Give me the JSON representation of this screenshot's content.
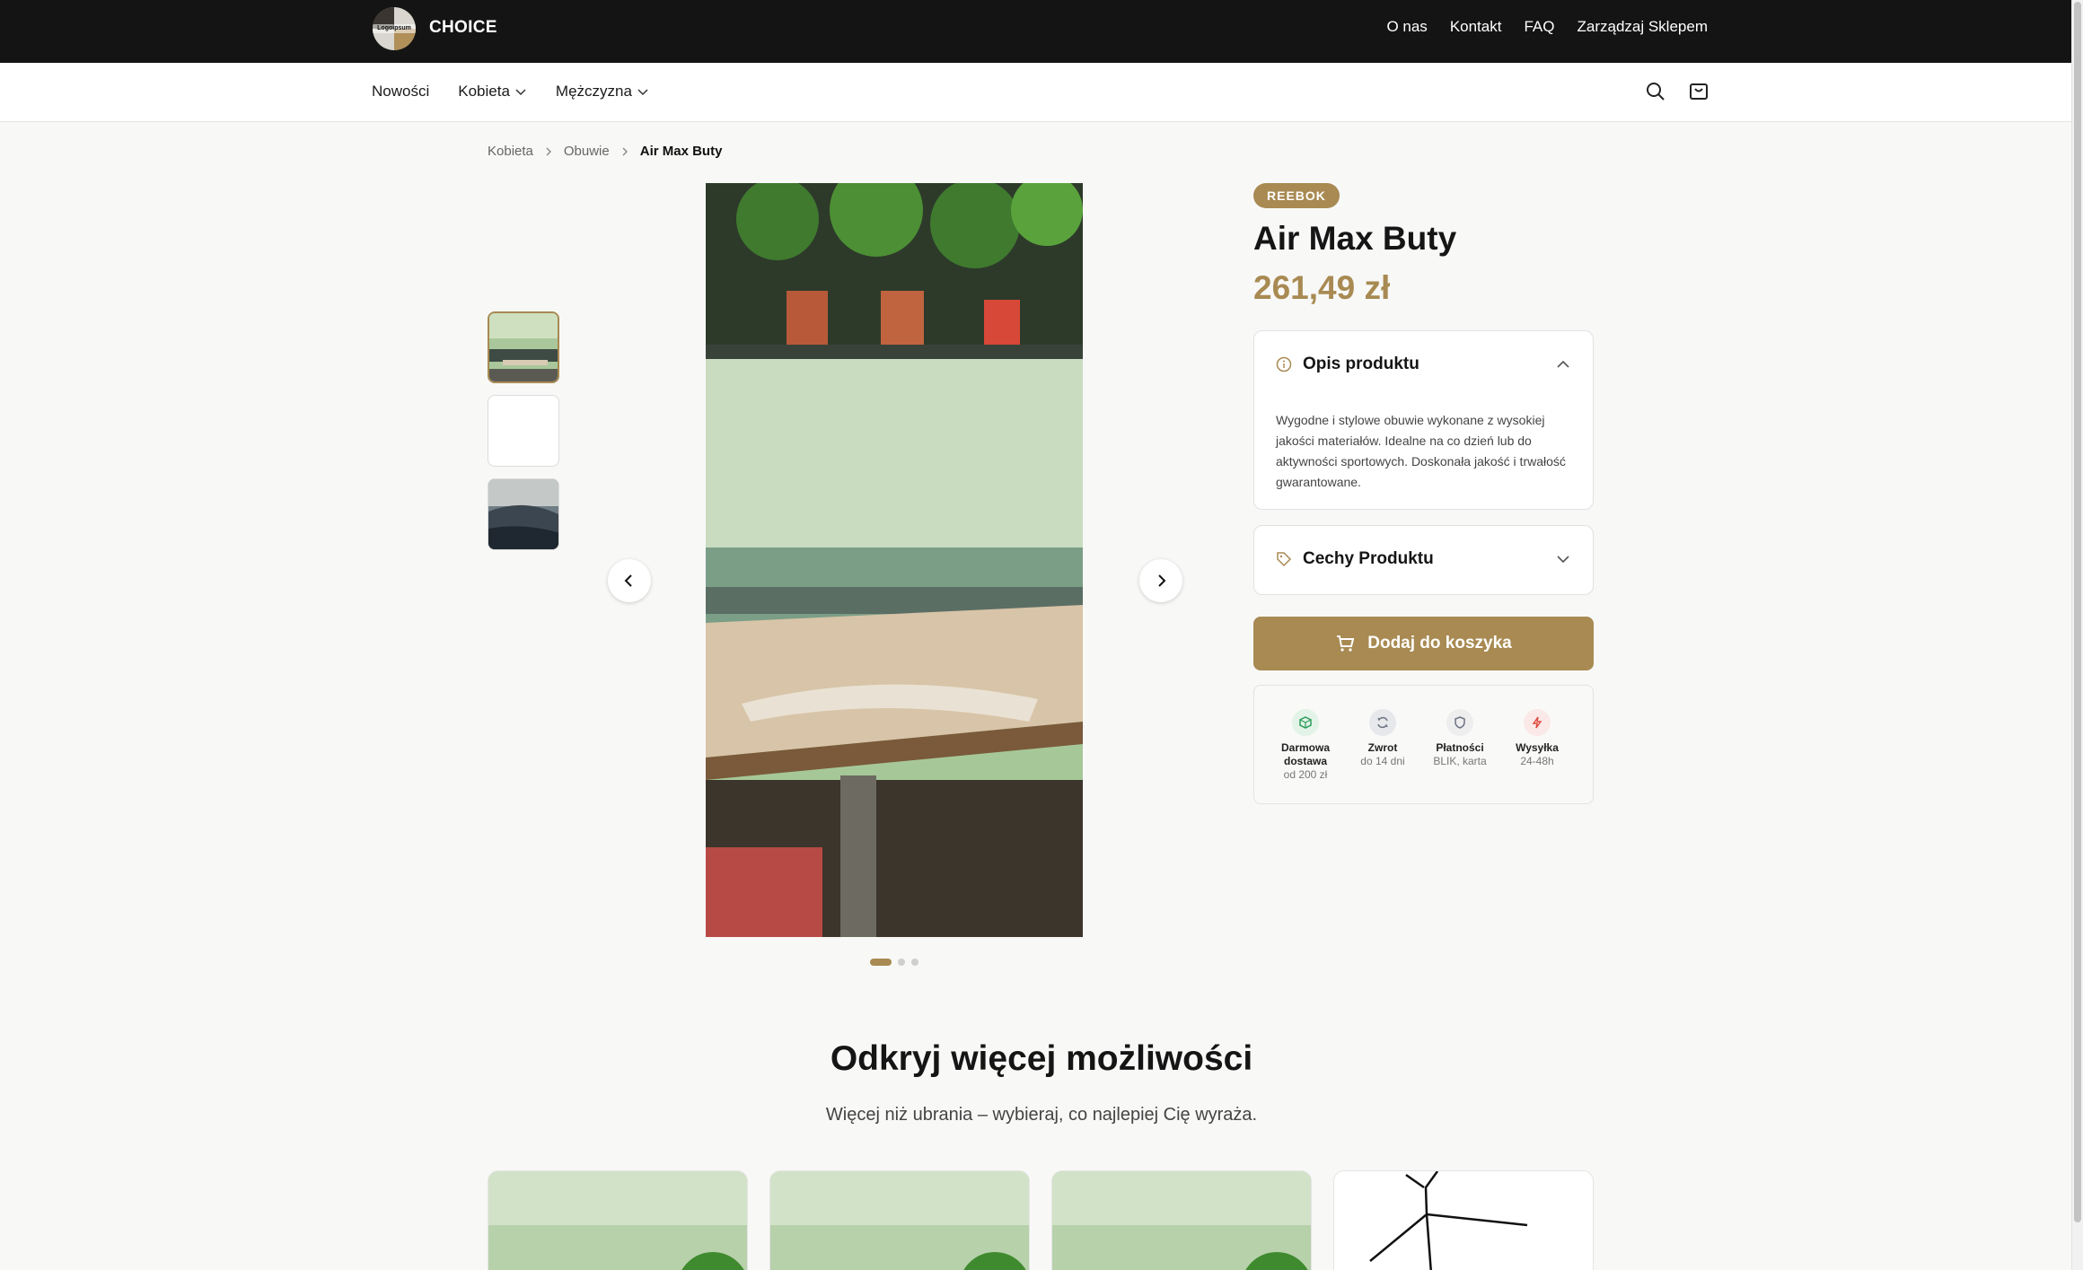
{
  "brand": {
    "name": "CHOICE",
    "logo_text": "Logoipsum"
  },
  "top_links": [
    "O nas",
    "Kontakt",
    "FAQ",
    "Zarządzaj Sklepem"
  ],
  "nav": {
    "items": [
      "Nowości",
      "Kobieta",
      "Mężczyzna"
    ]
  },
  "breadcrumb": [
    "Kobieta",
    "Obuwie",
    "Air Max Buty"
  ],
  "product": {
    "badge": "REEBOK",
    "title": "Air Max Buty",
    "price": "261,49 zł",
    "description_header": "Opis produktu",
    "description": "Wygodne i stylowe obuwie wykonane z wysokiej jakości materiałów. Idealne na co dzień lub do aktywności sportowych. Doskonała jakość i trwałość gwarantowane.",
    "features_header": "Cechy Produktu",
    "add_to_cart": "Dodaj do koszyka"
  },
  "benefits": [
    {
      "title": "Darmowa dostawa",
      "subtitle": "od 200 zł",
      "icon": "box-icon",
      "color": "#2e9d5a"
    },
    {
      "title": "Zwrot",
      "subtitle": "do 14 dni",
      "icon": "refresh-icon",
      "color": "#6b7280"
    },
    {
      "title": "Płatności",
      "subtitle": "BLIK, karta",
      "icon": "shield-icon",
      "color": "#6b7280"
    },
    {
      "title": "Wysyłka",
      "subtitle": "24-48h",
      "icon": "bolt-icon",
      "color": "#e0483e"
    }
  ],
  "gallery": {
    "image_count": 3,
    "active_index": 0
  },
  "section": {
    "title": "Odkryj więcej możliwości",
    "subtitle": "Więcej niż ubrania – wybieraj, co najlepiej Cię wyraża."
  },
  "colors": {
    "accent": "#a88a52",
    "topbar": "#141414"
  }
}
